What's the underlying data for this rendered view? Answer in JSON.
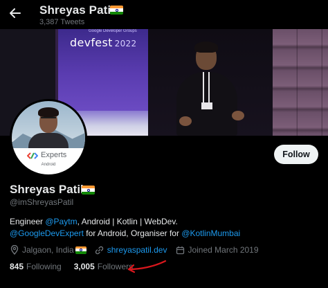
{
  "header": {
    "name": "Shreyas Patil",
    "tweet_count": "3,387 Tweets"
  },
  "banner": {
    "event_subtitle": "Google Developer Groups",
    "event_name": "devfest",
    "event_year": "2022"
  },
  "avatar": {
    "badge_title": "Experts",
    "badge_subtitle": "Android"
  },
  "actions": {
    "follow_label": "Follow"
  },
  "profile": {
    "name": "Shreyas Patil",
    "handle": "@imShreyasPatil",
    "bio": {
      "t1": "Engineer ",
      "m1": "@Paytm",
      "t2": ", Android | Kotlin | WebDev.",
      "m2": "@GoogleDevExpert",
      "t3": " for Android, Organiser for ",
      "m3": "@KotlinMumbai"
    },
    "location": "Jalgaon, India",
    "website": "shreyaspatil.dev",
    "joined": "Joined March 2019"
  },
  "stats": {
    "following_count": "845",
    "following_label": "Following",
    "followers_count": "3,005",
    "followers_label": "Followers"
  },
  "colors": {
    "accent": "#1d9bf0",
    "background": "#000000",
    "annotation_arrow": "#d9171d"
  },
  "icons": [
    "back-arrow-icon",
    "india-flag-icon",
    "location-pin-icon",
    "link-icon",
    "calendar-icon"
  ]
}
